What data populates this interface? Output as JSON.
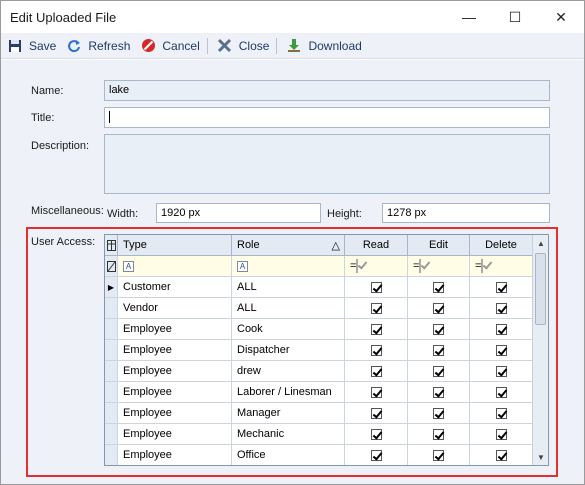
{
  "window": {
    "title": "Edit Uploaded File",
    "minimize": "—",
    "maximize": "☐",
    "close": "✕"
  },
  "toolbar": {
    "save": "Save",
    "refresh": "Refresh",
    "cancel": "Cancel",
    "close": "Close",
    "download": "Download"
  },
  "form": {
    "name_label": "Name:",
    "name_value": "lake",
    "title_label": "Title:",
    "title_value": "",
    "description_label": "Description:",
    "description_value": "",
    "misc_label": "Miscellaneous:",
    "width_label": "Width:",
    "width_value": "1920 px",
    "height_label": "Height:",
    "height_value": "1278 px",
    "user_access_label": "User Access:"
  },
  "grid": {
    "columns": [
      "Type",
      "Role",
      "Read",
      "Edit",
      "Delete"
    ],
    "filter_eq": "=",
    "filter_a": "A",
    "sort_indicator": "△",
    "rows": [
      {
        "type": "Customer",
        "role": "ALL",
        "read": true,
        "edit": true,
        "del": true
      },
      {
        "type": "Vendor",
        "role": "ALL",
        "read": true,
        "edit": true,
        "del": true
      },
      {
        "type": "Employee",
        "role": "Cook",
        "read": true,
        "edit": true,
        "del": true
      },
      {
        "type": "Employee",
        "role": "Dispatcher",
        "read": true,
        "edit": true,
        "del": true
      },
      {
        "type": "Employee",
        "role": "drew",
        "read": true,
        "edit": true,
        "del": true
      },
      {
        "type": "Employee",
        "role": "Laborer / Linesman",
        "read": true,
        "edit": true,
        "del": true
      },
      {
        "type": "Employee",
        "role": "Manager",
        "read": true,
        "edit": true,
        "del": true
      },
      {
        "type": "Employee",
        "role": "Mechanic",
        "read": true,
        "edit": true,
        "del": true
      },
      {
        "type": "Employee",
        "role": "Office",
        "read": true,
        "edit": true,
        "del": true
      }
    ]
  },
  "colors": {
    "accent": "#1d3a66",
    "highlight": "#e03131",
    "filter_bg": "#fffde6",
    "panel_bg": "#eef2f8"
  }
}
